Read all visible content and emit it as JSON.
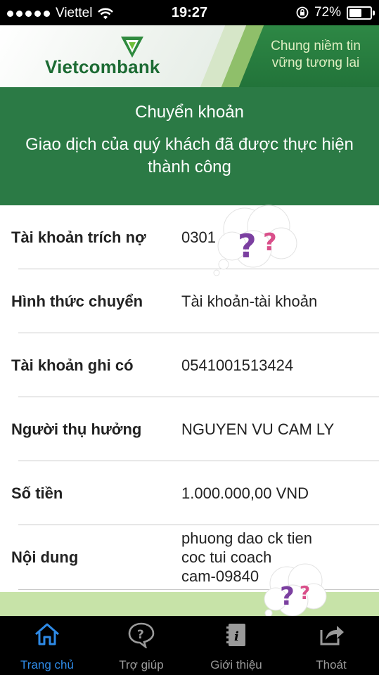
{
  "status_bar": {
    "carrier": "Viettel",
    "time": "19:27",
    "battery": "72%",
    "battery_level": 0.72
  },
  "banner": {
    "brand": "Vietcombank",
    "slogan_line1": "Chung niềm tin",
    "slogan_line2": "vững tương lai"
  },
  "transaction": {
    "title": "Chuyển khoản",
    "message": "Giao dịch của quý khách đã được thực hiện thành công"
  },
  "details": [
    {
      "label": "Tài khoản trích nợ",
      "value": "0301"
    },
    {
      "label": "Hình thức chuyển",
      "value": "Tài khoản-tài khoản"
    },
    {
      "label": "Tài khoản ghi có",
      "value": "0541001513424"
    },
    {
      "label": "Người thụ hưởng",
      "value": "NGUYEN VU CAM LY"
    },
    {
      "label": "Số tiền",
      "value": "1.000.000,00 VND"
    },
    {
      "label": "Nội dung",
      "value": "phuong dao ck tien\ncoc tui coach\ncam-09840"
    }
  ],
  "tabs": [
    {
      "label": "Trang chủ",
      "icon": "home-icon",
      "active": true
    },
    {
      "label": "Trợ giúp",
      "icon": "help-icon",
      "active": false
    },
    {
      "label": "Giới thiệu",
      "icon": "info-book-icon",
      "active": false
    },
    {
      "label": "Thoát",
      "icon": "exit-share-icon",
      "active": false
    }
  ],
  "colors": {
    "brand_green": "#2b7a45",
    "active_tab": "#2e8ae6",
    "bubble_q1": "#7b3fa0",
    "bubble_q2": "#d94f8a"
  }
}
